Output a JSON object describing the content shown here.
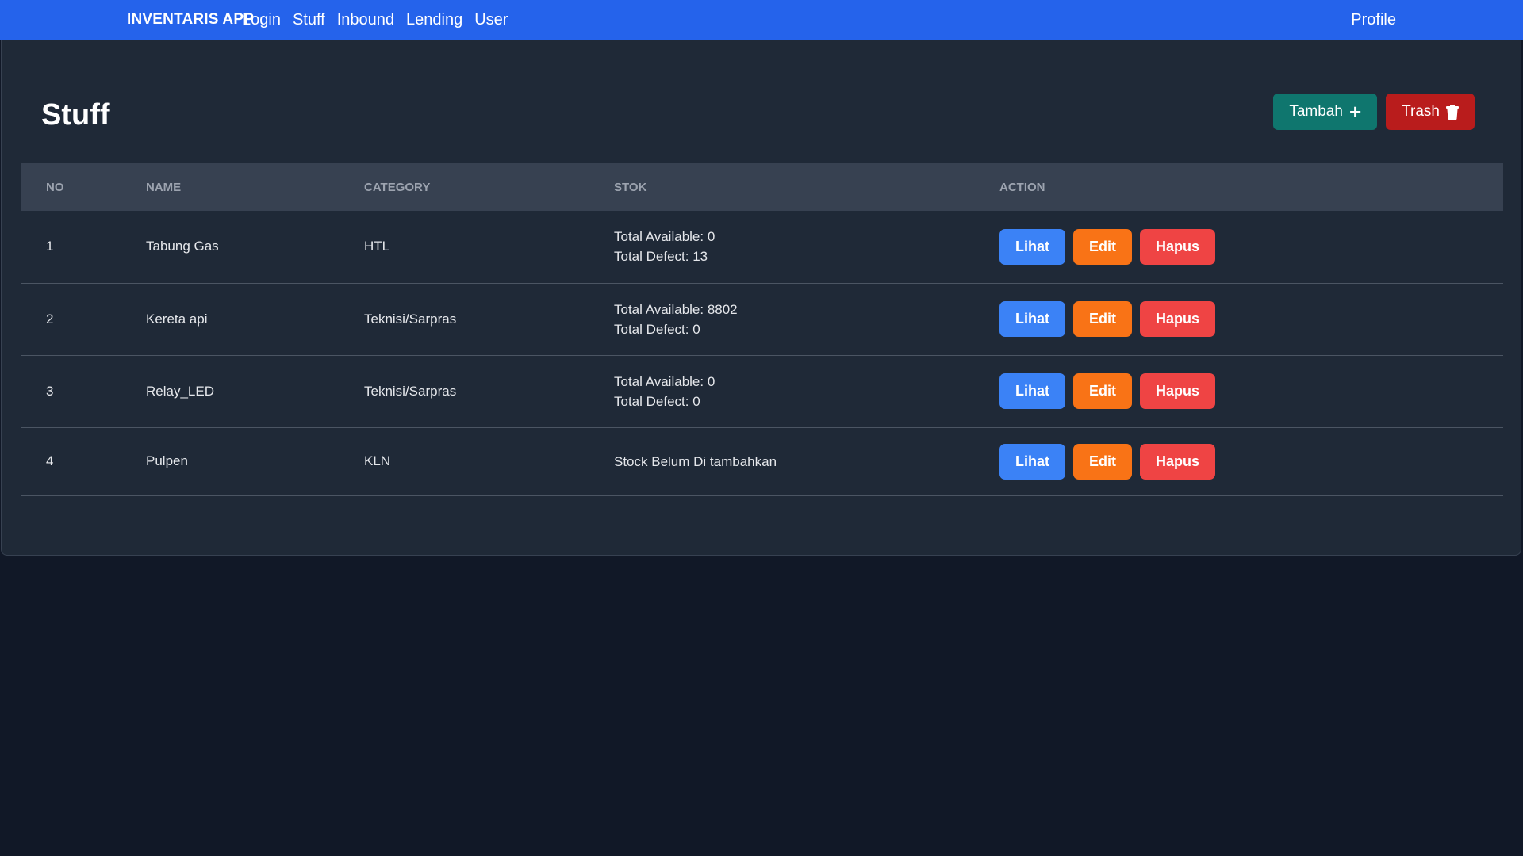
{
  "navbar": {
    "brand": "INVENTARIS APP",
    "links": [
      "Login",
      "Stuff",
      "Inbound",
      "Lending",
      "User"
    ],
    "profile": "Profile"
  },
  "page": {
    "title": "Stuff",
    "add_label": "Tambah",
    "trash_label": "Trash"
  },
  "table": {
    "headers": [
      "NO",
      "NAME",
      "CATEGORY",
      "STOK",
      "ACTION"
    ],
    "rows": [
      {
        "no": "1",
        "name": "Tabung Gas",
        "category": "HTL",
        "stok": [
          "Total Available: 0",
          "Total Defect: 13"
        ]
      },
      {
        "no": "2",
        "name": "Kereta api",
        "category": "Teknisi/Sarpras",
        "stok": [
          "Total Available: 8802",
          "Total Defect: 0"
        ]
      },
      {
        "no": "3",
        "name": "Relay_LED",
        "category": "Teknisi/Sarpras",
        "stok": [
          "Total Available: 0",
          "Total Defect: 0"
        ]
      },
      {
        "no": "4",
        "name": "Pulpen",
        "category": "KLN",
        "stok": [
          "Stock Belum Di tambahkan"
        ]
      }
    ],
    "actions": {
      "view": "Lihat",
      "edit": "Edit",
      "delete": "Hapus"
    }
  },
  "colors": {
    "navbar": "#2563eb",
    "background": "#111827",
    "card": "#1f2937",
    "add_button": "#0f766e",
    "trash_button": "#b91c1c",
    "view_button": "#3b82f6",
    "edit_button": "#f97316",
    "delete_button": "#ef4444"
  }
}
